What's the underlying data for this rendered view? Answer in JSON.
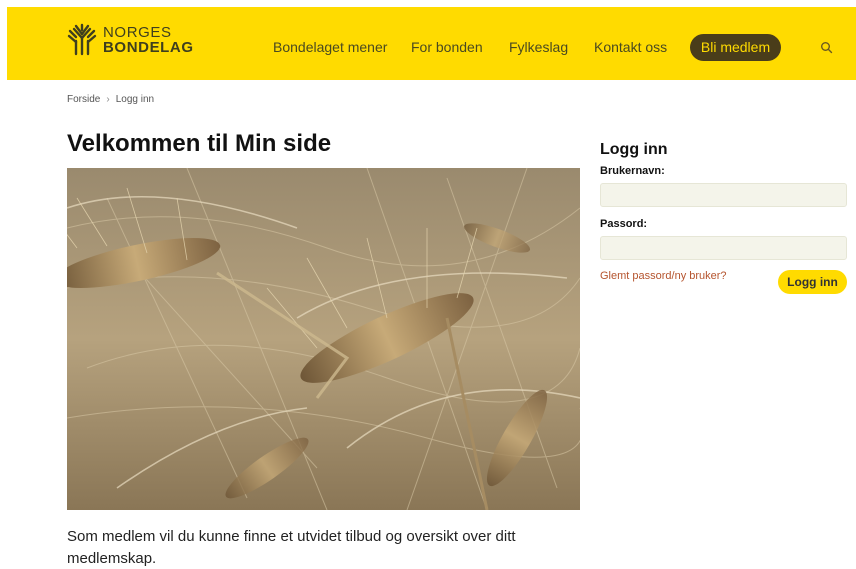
{
  "header": {
    "logo": {
      "line1": "NORGES",
      "line2": "BONDELAG",
      "icon": "wheat-logo-icon"
    },
    "nav": [
      {
        "label": "Bondelaget mener"
      },
      {
        "label": "For bonden"
      },
      {
        "label": "Fylkeslag"
      },
      {
        "label": "Kontakt oss"
      }
    ],
    "cta_label": "Bli medlem",
    "search_icon": "search-icon",
    "colors": {
      "brand_yellow": "#ffdb00",
      "dark_brown": "#4a3d1a"
    }
  },
  "breadcrumb": {
    "home": "Forside",
    "current": "Logg inn",
    "separator": "›"
  },
  "main": {
    "title": "Velkommen til Min side",
    "hero_image": "barley-field-image",
    "intro": "Som medlem vil du kunne finne et utvidet tilbud og oversikt over ditt medlemskap."
  },
  "login": {
    "title": "Logg inn",
    "username_label": "Brukernavn:",
    "username_value": "",
    "password_label": "Passord:",
    "password_value": "",
    "forgot_link": "Glemt passord/ny bruker?",
    "submit_label": "Logg inn",
    "colors": {
      "link": "#b5542e",
      "button": "#ffdb00"
    }
  }
}
